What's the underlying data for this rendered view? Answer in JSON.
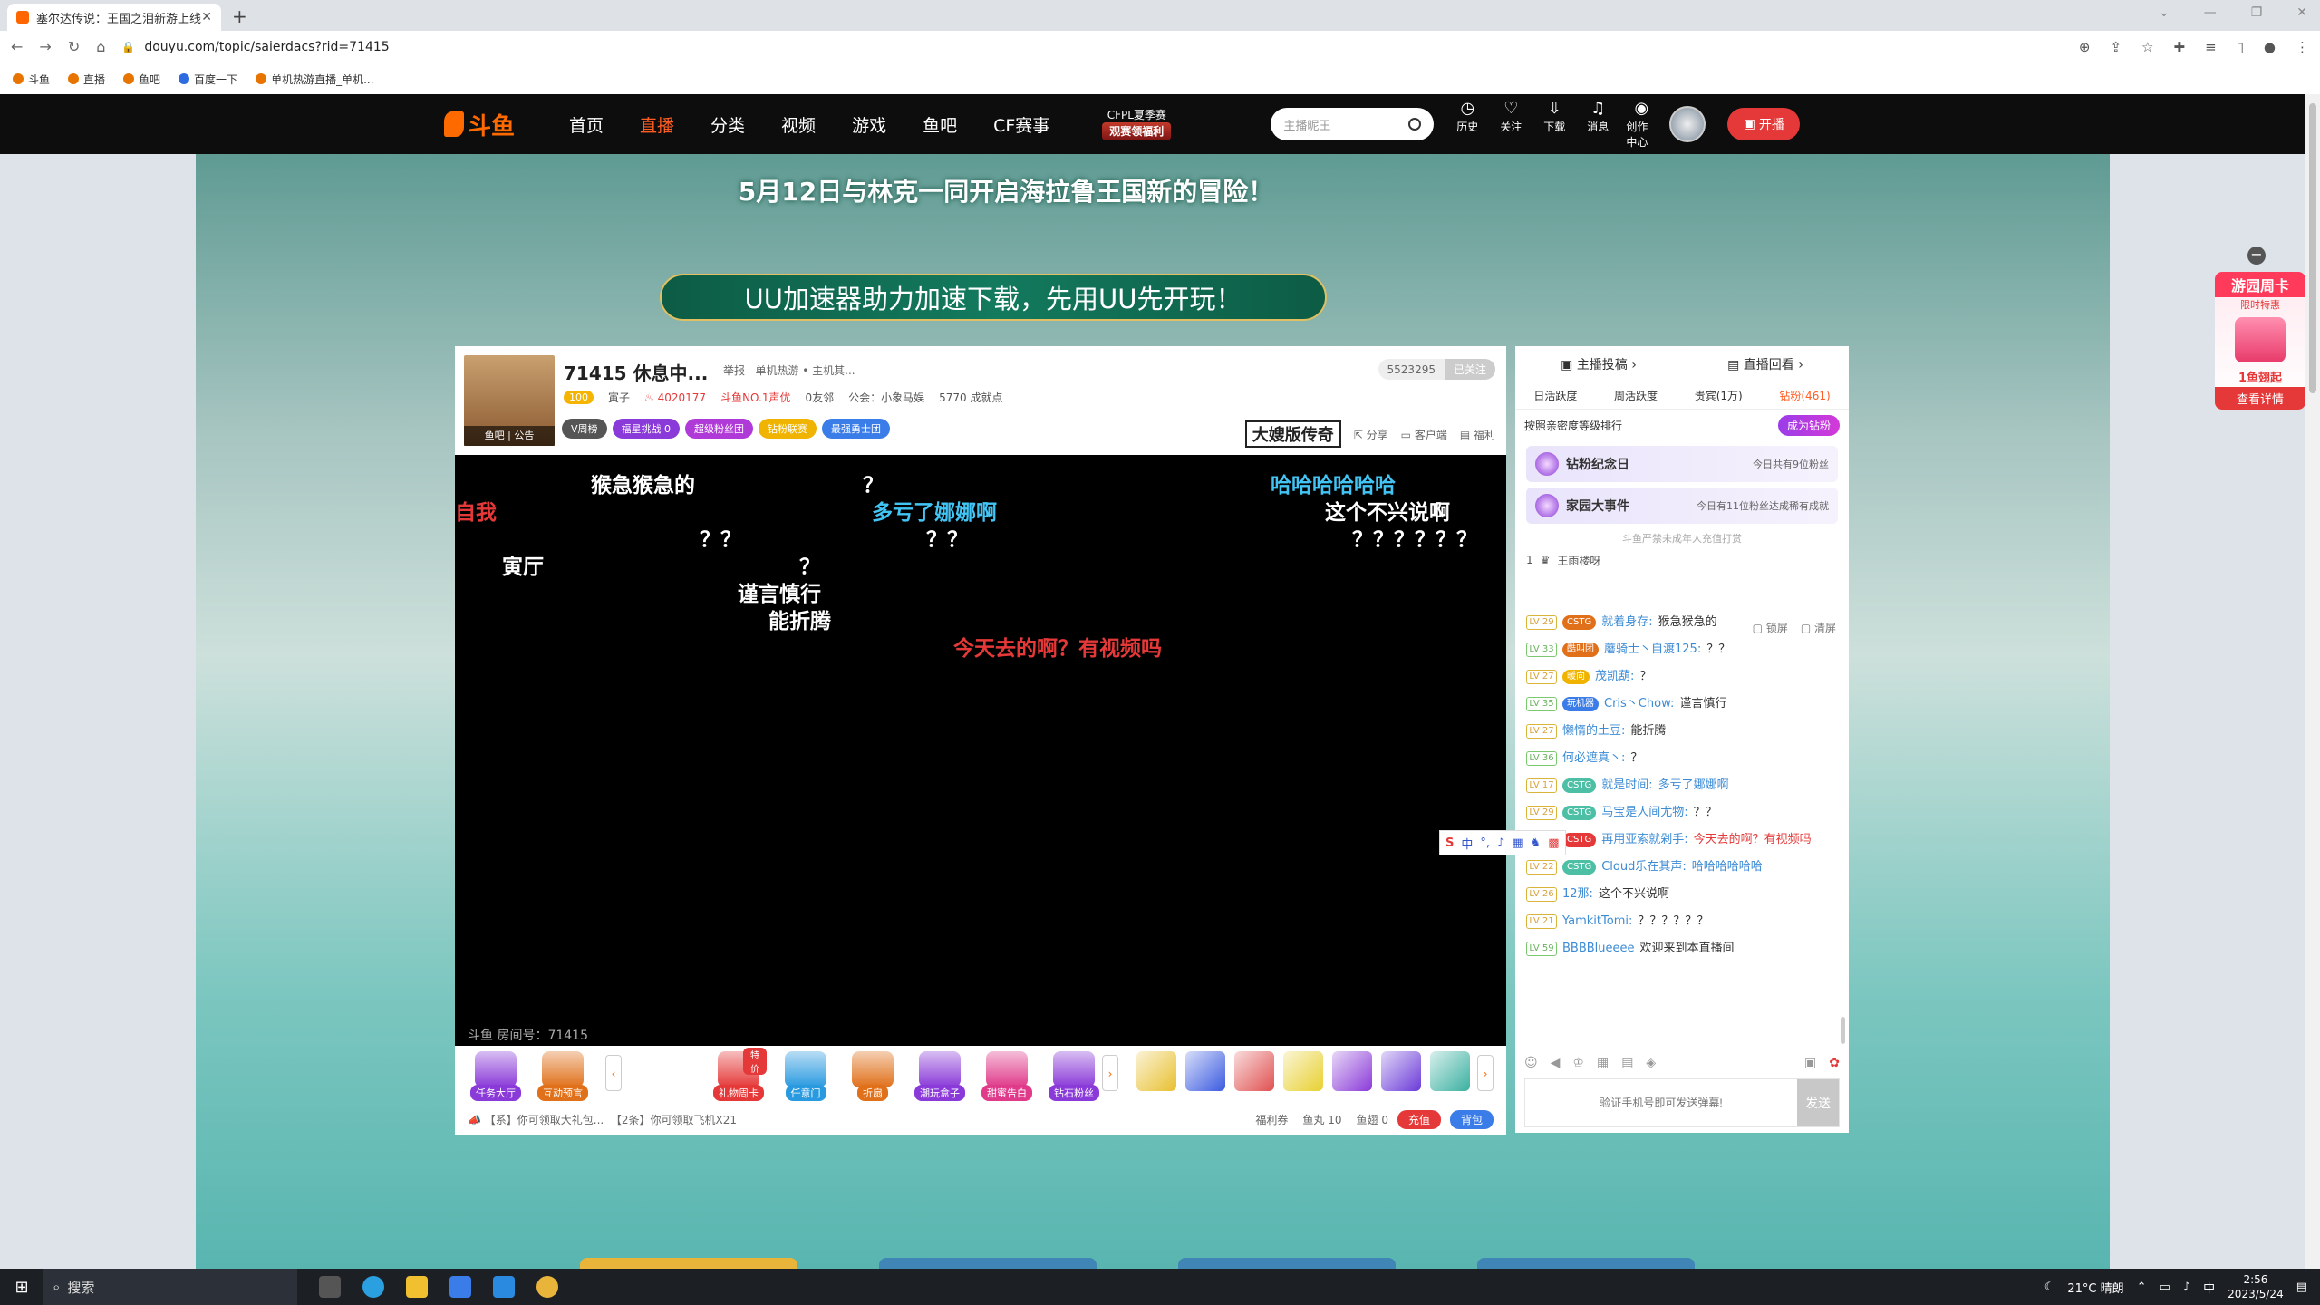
{
  "browser": {
    "tab_title": "塞尔达传说：王国之泪新游上线",
    "close": "✕",
    "new_tab": "+",
    "url": "douyu.com/topic/saierdacs?rid=71415",
    "bookmarks": [
      "斗鱼",
      "直播",
      "鱼吧",
      "百度一下",
      "单机热游直播_单机..."
    ]
  },
  "header": {
    "logo": "斗鱼",
    "menu": [
      "首页",
      "直播",
      "分类",
      "视频",
      "游戏",
      "鱼吧",
      "CF赛事"
    ],
    "active_menu": "直播",
    "cfpl_top": "CFPL夏季赛",
    "cfpl_bottom": "观赛领福利",
    "search_placeholder": "主播昵王",
    "icons": [
      "历史",
      "关注",
      "下载",
      "消息",
      "创作中心"
    ],
    "kaibo": "开播"
  },
  "banner": {
    "line1": "5月12日与林克一同开启海拉鲁王国新的冒险！",
    "line2": "UU加速器助力加速下载，先用UU先开玩！"
  },
  "room": {
    "title": "71415 休息中...",
    "report": "举报",
    "category": "单机热游 • 主机其...",
    "avatar_tabs": "鱼吧 | 公告",
    "level": "100",
    "rank": "寅子",
    "hot": "4020177",
    "honor": "斗鱼NO.1声优",
    "friends": "0友邻",
    "guild": "公会：小象马娱",
    "achievements": "5770 成就点",
    "tags": [
      {
        "label": "V周榜",
        "color": "#555555"
      },
      {
        "label": "福星挑战 0",
        "color": "#8a3ad8"
      },
      {
        "label": "超级粉丝团",
        "color": "#b03ad8"
      },
      {
        "label": "钻粉联赛",
        "color": "#f0b400"
      },
      {
        "label": "最强勇士团",
        "color": "#3a7ce8"
      }
    ],
    "followers": "5523295",
    "follow_btn": "已关注",
    "sponsor": "大嫂版传奇",
    "actions": [
      "分享",
      "客户端",
      "福利"
    ],
    "room_no": "斗鱼 房间号：71415"
  },
  "danmaku": [
    {
      "text": "猴急猴急的",
      "color": "#ffffff"
    },
    {
      "text": "？",
      "color": "#ffffff"
    },
    {
      "text": "哈哈哈哈哈哈",
      "color": "#42c5f5"
    },
    {
      "text": "自我",
      "color": "#e53939"
    },
    {
      "text": "多亏了娜娜啊",
      "color": "#42c5f5"
    },
    {
      "text": "这个不兴说啊",
      "color": "#ffffff"
    },
    {
      "text": "？？",
      "color": "#ffffff"
    },
    {
      "text": "？？",
      "color": "#ffffff"
    },
    {
      "text": "？？？？？？",
      "color": "#ffffff"
    },
    {
      "text": "寅厅",
      "color": "#ffffff"
    },
    {
      "text": "？",
      "color": "#ffffff"
    },
    {
      "text": "谨言慎行",
      "color": "#ffffff"
    },
    {
      "text": "能折腾",
      "color": "#ffffff"
    },
    {
      "text": "今天去的啊？有视频吗",
      "color": "#e53939"
    }
  ],
  "toolbar": {
    "left_items": [
      {
        "label": "任务大厅",
        "color": "#8a3ad8"
      },
      {
        "label": "互动预言",
        "color": "#e0701a"
      }
    ],
    "gifts": [
      {
        "label": "礼物周卡",
        "color": "#e53939",
        "badge": "特价"
      },
      {
        "label": "任意门",
        "color": "#2a9ae0"
      },
      {
        "label": "折扇",
        "color": "#e0701a"
      },
      {
        "label": "潮玩盒子",
        "color": "#8a3ad8"
      },
      {
        "label": "甜蜜告白",
        "color": "#e03a8a"
      },
      {
        "label": "钻石粉丝",
        "color": "#8a3ad8"
      }
    ],
    "ticker_1": "【系】你可领取大礼包...",
    "ticker_2": "【2条】你可领取飞机X21",
    "welfare": "福利券",
    "fishball": "鱼丸 10",
    "fishwing": "鱼翅 0",
    "recharge": "充值",
    "backpack": "背包"
  },
  "chat": {
    "top_tabs": [
      "主播投稿",
      "直播回看"
    ],
    "rank_tabs": [
      "日活跃度",
      "周活跃度",
      "贵宾(1万)",
      "钻粉(461)"
    ],
    "active_rank_tab": "钻粉(461)",
    "rank_desc": "按照亲密度等级排行",
    "become_btn": "成为钻粉",
    "event1_title": "钻粉纪念日",
    "event1_desc": "今日共有9位粉丝",
    "event2_title": "家园大事件",
    "event2_desc": "今日有11位粉丝达成稀有成就",
    "notice": "斗鱼严禁未成年人充值打赏",
    "top1_rank": "1",
    "top1_name": "王雨楼呀",
    "lock_screen": "锁屏",
    "clear_screen": "清屏",
    "messages": [
      {
        "lv": "LV 29",
        "badge": "CSTG",
        "bc": "#e0701a",
        "name": "就着身存:",
        "text": "猴急猴急的"
      },
      {
        "lv": "LV 33",
        "badge": "酷叫团",
        "bc": "#e0701a",
        "name": "蘑骑士丶自渡125:",
        "text": "？？"
      },
      {
        "lv": "LV 27",
        "badge": "暖向",
        "bc": "#f0b400",
        "name": "茂凯葫:",
        "text": "？"
      },
      {
        "lv": "LV 35",
        "badge": "玩机器",
        "bc": "#3a7ce8",
        "name": "Cris丶Chow:",
        "text": "谨言慎行"
      },
      {
        "lv": "LV 27",
        "badge": "",
        "bc": "#e0701a",
        "name": "懒惰的土豆:",
        "text": "能折腾"
      },
      {
        "lv": "LV 36",
        "badge": "",
        "bc": "",
        "name": "何必遮真丶:",
        "text": "？"
      },
      {
        "lv": "LV 17",
        "badge": "CSTG",
        "bc": "#4cbfa5",
        "name": "就是时间:",
        "text": "多亏了娜娜啊"
      },
      {
        "lv": "LV 29",
        "badge": "CSTG",
        "bc": "#4cbfa5",
        "name": "马宝是人间尤物:",
        "text": "？？"
      },
      {
        "lv": "LV 36",
        "badge": "CSTG",
        "bc": "#e53939",
        "name": "再用亚索就剁手:",
        "text": "今天去的啊？有视频吗"
      },
      {
        "lv": "LV 22",
        "badge": "CSTG",
        "bc": "#4cbfa5",
        "name": "Cloud乐在其声:",
        "text": "哈哈哈哈哈哈"
      },
      {
        "lv": "LV 26",
        "badge": "",
        "bc": "",
        "name": "12那:",
        "text": "这个不兴说啊"
      },
      {
        "lv": "LV 21",
        "badge": "",
        "bc": "",
        "name": "YamkitTomi:",
        "text": "？？？？？？"
      },
      {
        "lv": "LV 59",
        "badge": "",
        "bc": "#e53939",
        "name": "BBBBlueeee",
        "text": "欢迎来到本直播间"
      }
    ],
    "input_placeholder": "验证手机号即可发送弹幕!",
    "send": "发送"
  },
  "side_card": {
    "title": "游园周卡",
    "sub": "限时特惠",
    "price": "1鱼翅起",
    "detail": "查看详情"
  },
  "ime": {
    "logo": "S",
    "mode": "中"
  },
  "taskbar": {
    "search": "搜索",
    "weather": "21°C 晴朗",
    "ime": "中",
    "time": "2:56",
    "date": "2023/5/24"
  }
}
